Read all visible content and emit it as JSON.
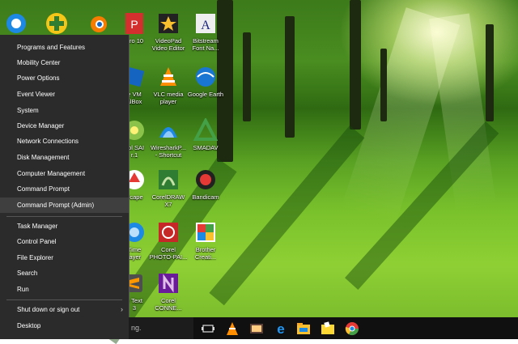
{
  "start_menu": {
    "items": [
      {
        "label": "Programs and Features"
      },
      {
        "label": "Mobility Center"
      },
      {
        "label": "Power Options"
      },
      {
        "label": "Event Viewer"
      },
      {
        "label": "System"
      },
      {
        "label": "Device Manager"
      },
      {
        "label": "Network Connections"
      },
      {
        "label": "Disk Management"
      },
      {
        "label": "Computer Management"
      },
      {
        "label": "Command Prompt"
      },
      {
        "label": "Command Prompt (Admin)"
      },
      {
        "label": "Task Manager"
      },
      {
        "label": "Control Panel"
      },
      {
        "label": "File Explorer"
      },
      {
        "label": "Search"
      },
      {
        "label": "Run"
      },
      {
        "label": "Shut down or sign out"
      },
      {
        "label": "Desktop"
      }
    ],
    "highlighted": "Command Prompt (Admin)",
    "submenu_arrow": "›"
  },
  "desktop_icons": [
    {
      "label": "Pro 10",
      "icon": "pdf-editor-icon"
    },
    {
      "label": "VideoPad\nVideo Editor",
      "icon": "videopad-icon"
    },
    {
      "label": "Bitstream\nFont Na...",
      "icon": "bitstream-font-icon"
    },
    {
      "label": "e VM\nalBox",
      "icon": "virtualbox-icon"
    },
    {
      "label": "VLC media\nplayer",
      "icon": "vlc-icon"
    },
    {
      "label": "Google Earth",
      "icon": "google-earth-icon"
    },
    {
      "label": "ool SAI\nr.1",
      "icon": "paint-tool-sai-icon"
    },
    {
      "label": "WiresharkP...\n- Shortcut",
      "icon": "wireshark-icon"
    },
    {
      "label": "SMADAV",
      "icon": "smadav-icon"
    },
    {
      "label": "Scape",
      "icon": "inkscape-icon"
    },
    {
      "label": "CorelDRAW\nX7",
      "icon": "coreldraw-icon"
    },
    {
      "label": "Bandicam",
      "icon": "bandicam-icon"
    },
    {
      "label": "Time\nlayer",
      "icon": "quicktime-icon"
    },
    {
      "label": "Corel\nPHOTO-PAI...",
      "icon": "corel-photopaint-icon"
    },
    {
      "label": "Brother\nCreati...",
      "icon": "brother-creative-icon"
    },
    {
      "label": "e Text\n3",
      "icon": "sublime-text-icon"
    },
    {
      "label": "Corel\nCONNE...",
      "icon": "corel-connect-icon"
    }
  ],
  "taskbar": {
    "search_fragment": "ng.",
    "icons": [
      "task-view-icon",
      "vlc-taskbar-icon",
      "media-taskbar-icon",
      "edge-icon",
      "file-explorer-icon",
      "folder-icon",
      "chrome-icon"
    ]
  }
}
